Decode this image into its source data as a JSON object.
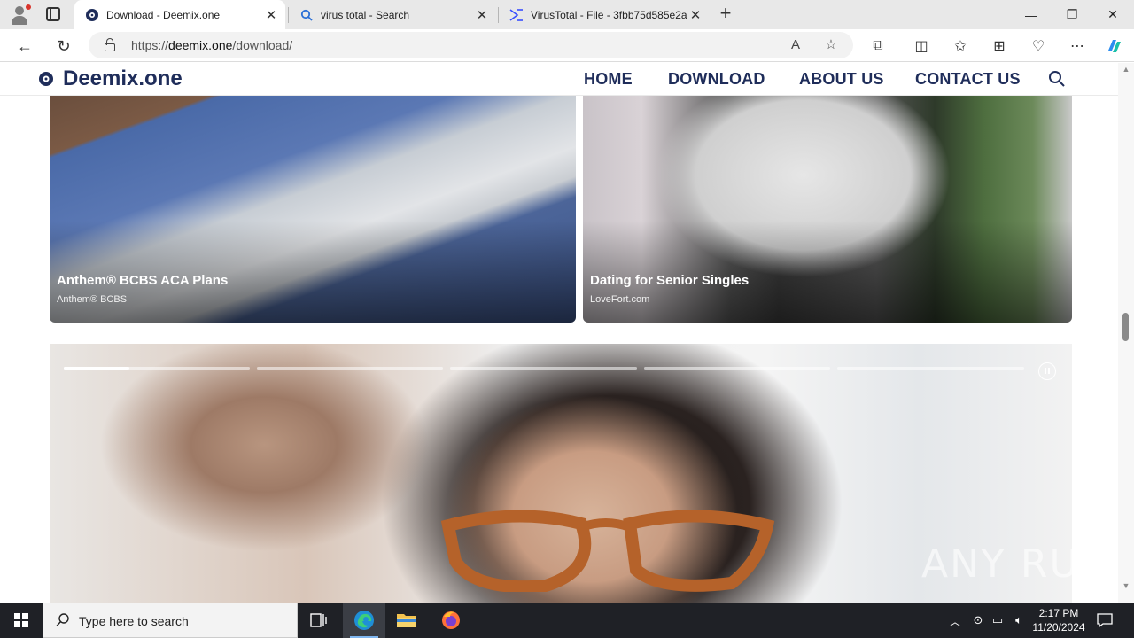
{
  "browser": {
    "tabs": [
      {
        "title": "Download - Deemix.one",
        "active": true,
        "favicon": "deemix-favicon"
      },
      {
        "title": "virus total - Search",
        "active": false,
        "favicon": "search-favicon"
      },
      {
        "title": "VirusTotal - File - 3fbb75d585e2a",
        "active": false,
        "favicon": "virustotal-favicon"
      }
    ],
    "url_prefix": "https://",
    "url_domain": "deemix.one",
    "url_path": "/download/"
  },
  "site": {
    "logo_text": "Deemix.one",
    "nav": [
      "HOME",
      "DOWNLOAD",
      "ABOUT US",
      "CONTACT US"
    ]
  },
  "cards": [
    {
      "title": "Anthem® BCBS ACA Plans",
      "source": "Anthem® BCBS"
    },
    {
      "title": "Dating for Senior Singles",
      "source": "LoveFort.com"
    }
  ],
  "slideshow": {
    "slide_count": 5,
    "current_slide": 1,
    "current_progress": 0.35
  },
  "watermark": "ANY RUN",
  "taskbar": {
    "search_placeholder": "Type here to search",
    "time": "2:17 PM",
    "date": "11/20/2024"
  }
}
